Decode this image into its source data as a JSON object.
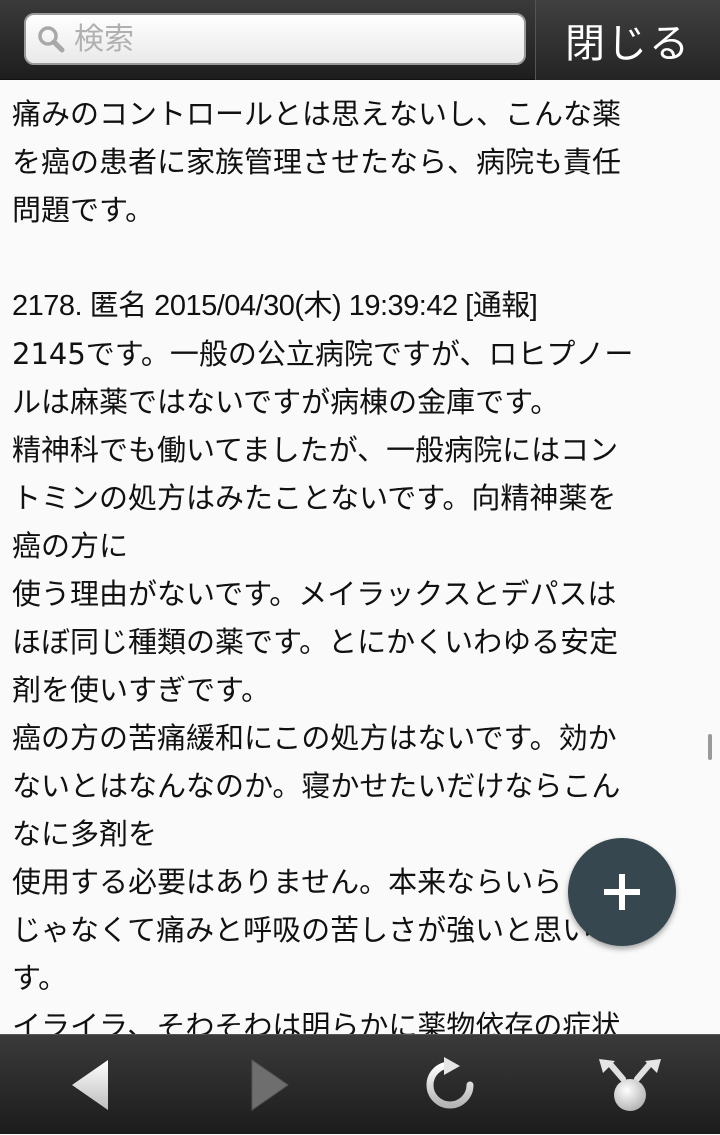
{
  "search": {
    "placeholder": "検索",
    "value": "",
    "icon": "search-icon"
  },
  "header": {
    "close_label": "閉じる"
  },
  "content": {
    "lines": [
      "痛みのコントロールとは思えないし、こんな薬",
      "を癌の患者に家族管理させたなら、病院も責任",
      "問題です。",
      "",
      "2178. 匿名 2015/04/30(木) 19:39:42 [通報]",
      "2145です。一般の公立病院ですが、ロヒプノー",
      "ルは麻薬ではないですが病棟の金庫です。",
      "精神科でも働いてましたが、一般病院にはコン",
      "トミンの処方はみたことないです。向精神薬を",
      "癌の方に",
      "使う理由がないです。メイラックスとデパスは",
      "ほぼ同じ種類の薬です。とにかくいわゆる安定",
      "剤を使いすぎです。",
      "癌の方の苦痛緩和にこの処方はないです。効か",
      "ないとはなんなのか。寝かせたいだけならこん",
      "なに多剤を",
      "使用する必要はありません。本来ならいら",
      "じゃなくて痛みと呼吸の苦しさが強いと思いま",
      "す。",
      "イライラ、そわそわは明らかに薬物依存の症状"
    ]
  },
  "fab": {
    "icon": "plus-icon"
  },
  "bottom_nav": {
    "items": [
      {
        "icon": "back-arrow-icon"
      },
      {
        "icon": "forward-arrow-icon"
      },
      {
        "icon": "refresh-icon"
      },
      {
        "icon": "share-icon"
      }
    ]
  },
  "colors": {
    "bar": "#2c2c2c",
    "fab": "#37474f",
    "text": "#111111",
    "background": "#fafafa"
  }
}
